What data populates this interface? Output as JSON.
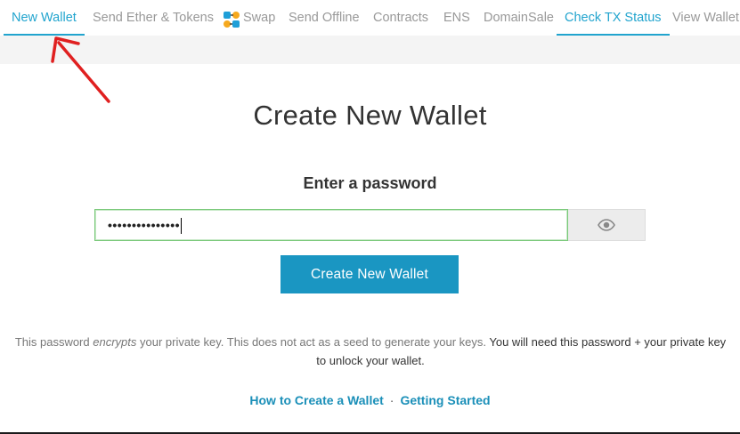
{
  "nav": {
    "items": [
      {
        "label": "New Wallet",
        "state": "active"
      },
      {
        "label": "Send Ether & Tokens"
      },
      {
        "label": "Swap",
        "icon": "swap-icon"
      },
      {
        "label": "Send Offline"
      },
      {
        "label": "Contracts"
      },
      {
        "label": "ENS"
      },
      {
        "label": "DomainSale"
      },
      {
        "label": "Check TX Status",
        "state": "highlighted"
      },
      {
        "label": "View Wallet"
      }
    ]
  },
  "annotation": {
    "icon": "red-arrow-icon",
    "color": "#e02020"
  },
  "main": {
    "title": "Create New Wallet",
    "password_label": "Enter a password",
    "password_value": "•••••••••••••••",
    "toggle_icon": "eye-icon",
    "create_button_label": "Create New Wallet",
    "info": {
      "part1": "This password ",
      "part2": "encrypts",
      "part3": " your private key. This does not act as a seed to generate your keys. ",
      "part4": "You will need this password + your private key to unlock your wallet."
    },
    "links": {
      "how_to": "How to Create a Wallet",
      "separator": "·",
      "getting_started": "Getting Started"
    }
  },
  "colors": {
    "accent": "#21a4ce",
    "button": "#1a96c2",
    "input_border": "#7ac97a"
  }
}
